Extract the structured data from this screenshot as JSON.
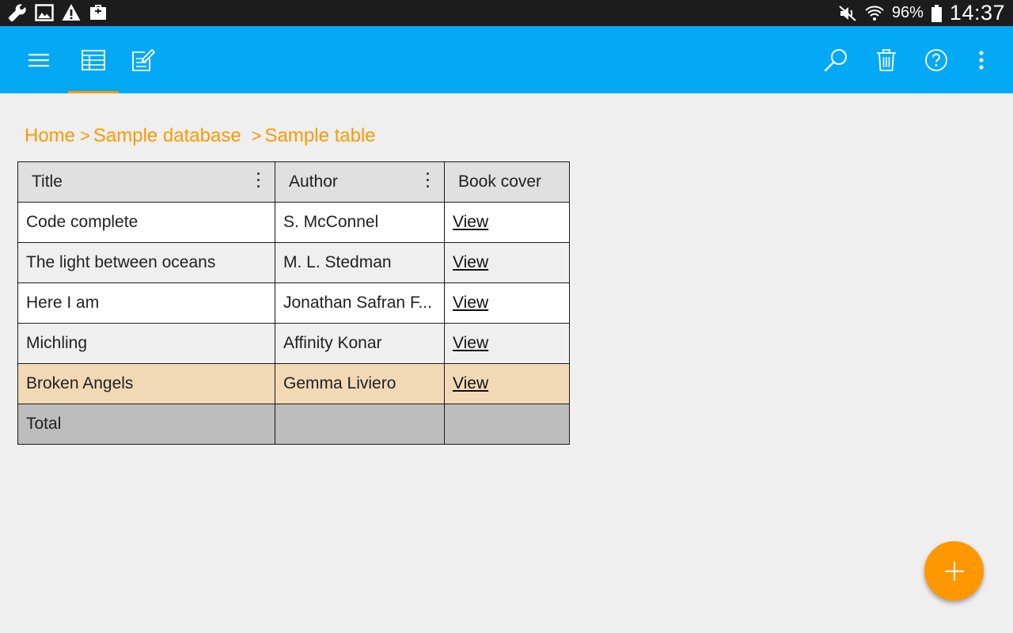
{
  "status_bar": {
    "left_icons": [
      "wrench-icon",
      "image-icon",
      "warning-icon",
      "briefcase-icon"
    ],
    "battery_percent": "96%",
    "time": "14:37"
  },
  "toolbar": {
    "background": "#03a9f4",
    "indicator_color": "#ff9800",
    "active_tab": "table-view"
  },
  "breadcrumb": {
    "items": [
      "Home",
      "Sample database",
      "Sample table"
    ],
    "separator": ">",
    "color": "#ff9800"
  },
  "table": {
    "headers": [
      "Title",
      "Author",
      "Book cover"
    ],
    "rows": [
      {
        "title": "Code complete",
        "author": "S. McConnel",
        "cover": "View"
      },
      {
        "title": "The light between oceans",
        "author": "M. L. Stedman",
        "cover": "View"
      },
      {
        "title": "Here I am",
        "author": "Jonathan Safran F...",
        "cover": "View"
      },
      {
        "title": "Michling",
        "author": "Affinity Konar",
        "cover": "View"
      },
      {
        "title": "Broken Angels",
        "author": "Gemma Liviero",
        "cover": "View"
      }
    ],
    "highlight_row": 5,
    "highlight_color": "#f2d9b6",
    "footer_label": "Total"
  },
  "fab": {
    "icon": "plus-icon",
    "color": "#ff9800"
  }
}
